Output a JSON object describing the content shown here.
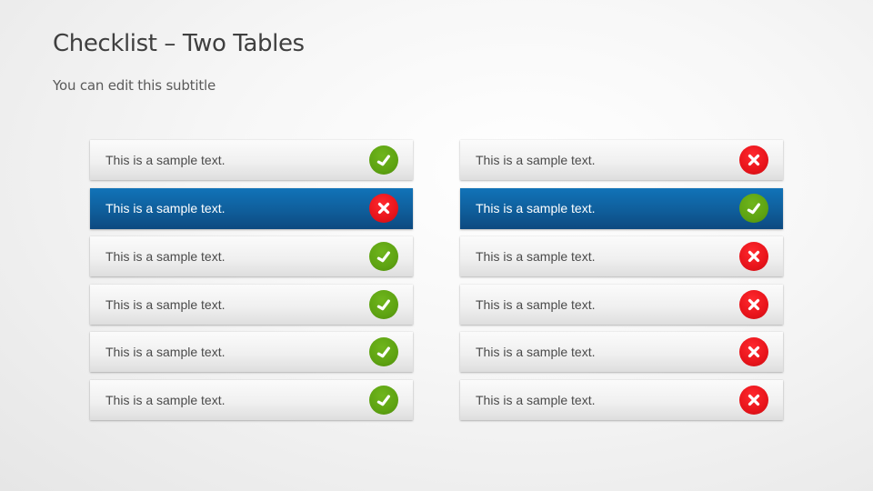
{
  "header": {
    "title": "Checklist – Two Tables",
    "subtitle": "You can edit this subtitle"
  },
  "colors": {
    "check": "#5ea312",
    "cross": "#e8141b",
    "highlight": "#0f5c98"
  },
  "tables": [
    {
      "name": "left",
      "rows": [
        {
          "text": "This is a sample text.",
          "status": "check",
          "highlighted": false
        },
        {
          "text": "This is a sample text.",
          "status": "cross",
          "highlighted": true
        },
        {
          "text": "This is a sample text.",
          "status": "check",
          "highlighted": false
        },
        {
          "text": "This is a sample text.",
          "status": "check",
          "highlighted": false
        },
        {
          "text": "This is a sample text.",
          "status": "check",
          "highlighted": false
        },
        {
          "text": "This is a sample text.",
          "status": "check",
          "highlighted": false
        }
      ]
    },
    {
      "name": "right",
      "rows": [
        {
          "text": "This is a sample text.",
          "status": "cross",
          "highlighted": false
        },
        {
          "text": "This is a sample text.",
          "status": "check",
          "highlighted": true
        },
        {
          "text": "This is a sample text.",
          "status": "cross",
          "highlighted": false
        },
        {
          "text": "This is a sample text.",
          "status": "cross",
          "highlighted": false
        },
        {
          "text": "This is a sample text.",
          "status": "cross",
          "highlighted": false
        },
        {
          "text": "This is a sample text.",
          "status": "cross",
          "highlighted": false
        }
      ]
    }
  ]
}
